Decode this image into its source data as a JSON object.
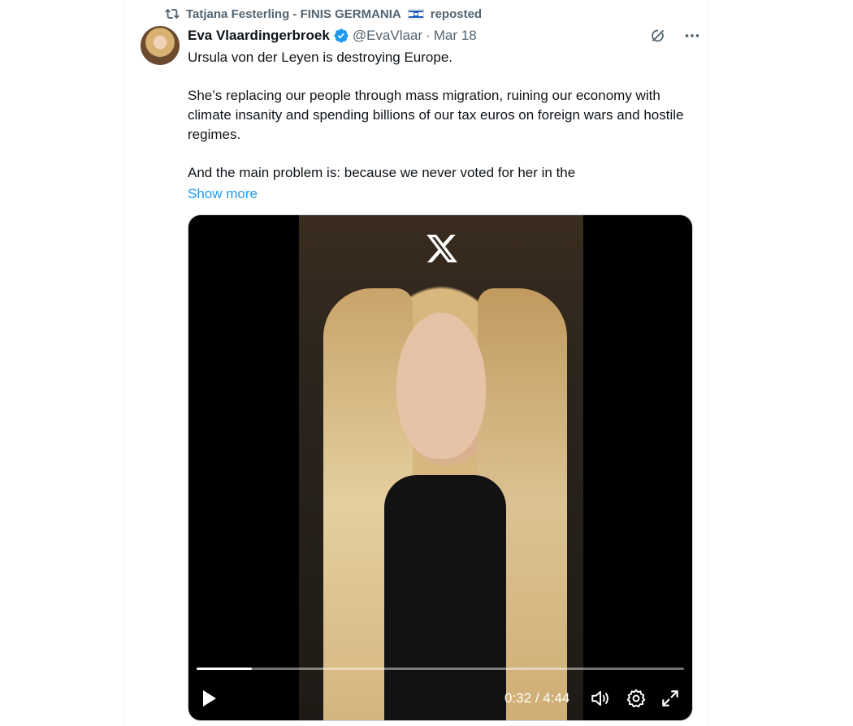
{
  "repost": {
    "reposter": "Tatjana Festerling - FINIS GERMANIA",
    "label": "reposted",
    "flag_icon": "israel-flag-icon"
  },
  "tweet": {
    "author_name": "Eva Vlaardingerbroek",
    "verified": true,
    "handle": "@EvaVlaar",
    "separator": "·",
    "date": "Mar 18",
    "paragraphs": [
      "Ursula von der Leyen is destroying Europe.",
      "She’s replacing our people through mass migration, ruining our economy with climate insanity and spending billions of our tax euros on foreign wars and hostile regimes.",
      "And the main problem is: because we never voted for her in the"
    ],
    "show_more": "Show more"
  },
  "video": {
    "current_time": "0:32",
    "time_separator": " / ",
    "duration": "4:44",
    "progress_fraction": 0.1127,
    "watermark": "x-logo-icon"
  },
  "colors": {
    "link": "#1d9bf0",
    "secondary_text": "#536471",
    "verified": "#1d9bf0"
  }
}
